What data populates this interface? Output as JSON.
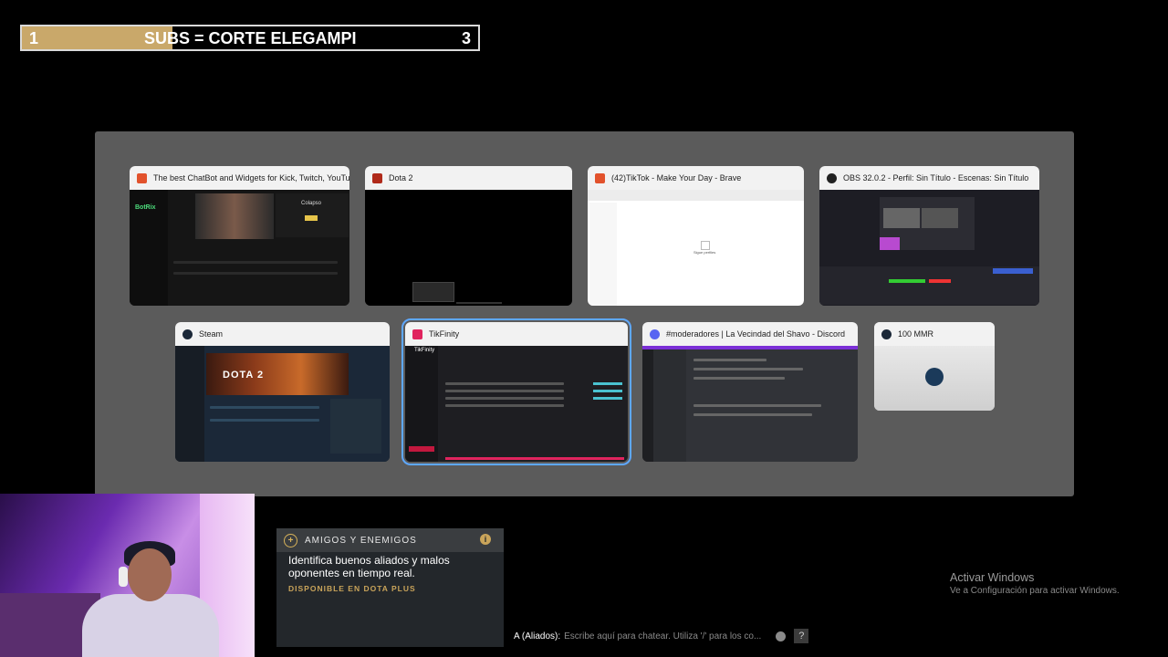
{
  "goal": {
    "left": "1",
    "text": "SUBS = CORTE ELEGAMPI",
    "right": "3",
    "progress_fraction": 0.33,
    "fill_color": "#c9a86a"
  },
  "switcher": {
    "windows": [
      {
        "title": "The best ChatBot and Widgets for Kick, Twitch, YouTube,...",
        "icon": "brave-icon",
        "icon_color": "#e2522c"
      },
      {
        "title": "Dota 2",
        "icon": "dota-icon",
        "icon_color": "#b02a1a"
      },
      {
        "title": "(42)TikTok - Make Your Day - Brave",
        "icon": "brave-icon",
        "icon_color": "#e2522c"
      },
      {
        "title": "OBS 32.0.2 - Perfil: Sin Título - Escenas: Sin Título",
        "icon": "obs-icon",
        "icon_color": "#222222"
      },
      {
        "title": "Steam",
        "icon": "steam-icon",
        "icon_color": "#1b2838"
      },
      {
        "title": "TikFinity",
        "icon": "tikfinity-icon",
        "icon_color": "#e0245e",
        "selected": true
      },
      {
        "title": "#moderadores | La Vecindad del Shavo - Discord",
        "icon": "discord-icon",
        "icon_color": "#5865f2"
      },
      {
        "title": "100 MMR",
        "icon": "steam-icon",
        "icon_color": "#1b2838"
      }
    ],
    "thumb_texts": {
      "botrix": "BotRix",
      "colapso": "Colapso",
      "dota2": "DOTA 2",
      "tiktok_empty": "Sigue perfiles",
      "tikfinity": "TikFinity"
    }
  },
  "dota_plus": {
    "title": "AMIGOS Y ENEMIGOS",
    "description": "Identifica buenos aliados y malos oponentes en tiempo real.",
    "availability": "DISPONIBLE EN DOTA PLUS"
  },
  "chat": {
    "label": "A (Aliados):",
    "placeholder": "Escribe aquí para chatear. Utiliza '/' para los co...",
    "help": "?"
  },
  "activate_windows": {
    "title": "Activar Windows",
    "subtitle": "Ve a Configuración para activar Windows."
  }
}
